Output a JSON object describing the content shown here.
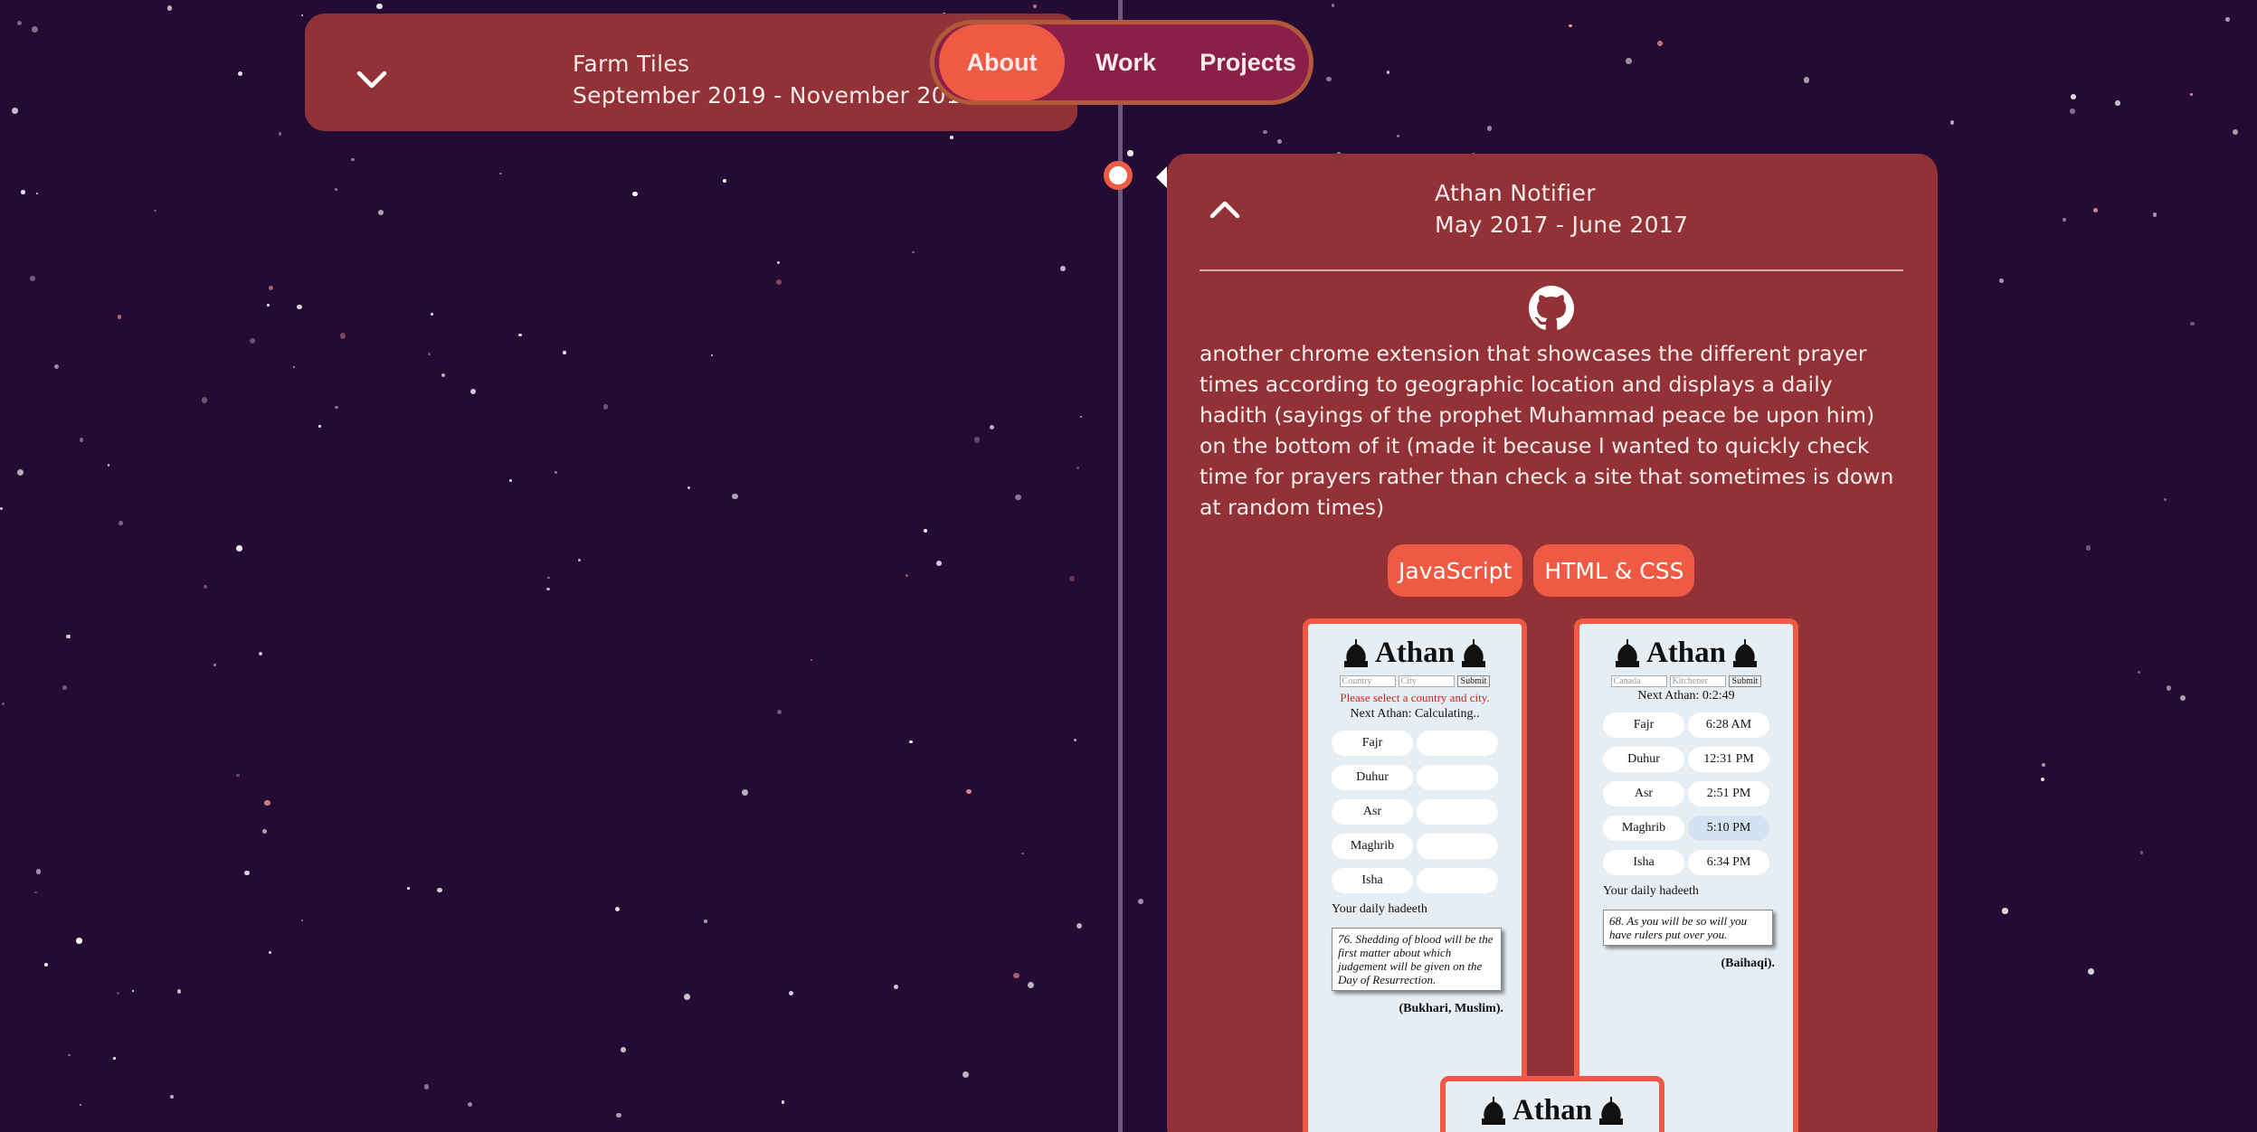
{
  "nav": {
    "items": [
      {
        "label": "About",
        "active": true
      },
      {
        "label": "Work",
        "active": false
      },
      {
        "label": "Projects",
        "active": false
      }
    ]
  },
  "top_card": {
    "title": "Farm Tiles",
    "dates": "September 2019 - November 2019",
    "toggle_icon": "chevron-down-icon"
  },
  "main_card": {
    "title": "Athan Notifier",
    "dates": "May 2017 - June 2017",
    "toggle_icon": "chevron-up-icon",
    "link_icon": "github-icon",
    "description": "another chrome extension that showcases the different prayer times according to geographic location and displays a daily hadith (sayings of the prophet Muhammad peace be upon him) on the bottom of it (made it because I wanted to quickly check time for prayers rather than check a site that sometimes is down at random times)",
    "tags": [
      "JavaScript",
      "HTML & CSS"
    ]
  },
  "screenshots": [
    {
      "heading": "Athan",
      "country_placeholder": "Country",
      "city_placeholder": "City",
      "submit": "Submit",
      "warning": "Please select a country and city.",
      "next_athan": "Next Athan: Calculating..",
      "prayers": [
        {
          "name": "Fajr",
          "time": ""
        },
        {
          "name": "Duhur",
          "time": ""
        },
        {
          "name": "Asr",
          "time": ""
        },
        {
          "name": "Maghrib",
          "time": ""
        },
        {
          "name": "Isha",
          "time": ""
        }
      ],
      "daily_label": "Your daily hadeeth",
      "hadith": "76. Shedding of blood will be the first matter about which judgement will be given on the Day of Resurrection.",
      "source": "(Bukhari, Muslim)."
    },
    {
      "heading": "Athan",
      "country_placeholder": "Canada",
      "city_placeholder": "Kitchener",
      "submit": "Submit",
      "next_athan": "Next Athan: 0:2:49",
      "prayers": [
        {
          "name": "Fajr",
          "time": "6:28 AM"
        },
        {
          "name": "Duhur",
          "time": "12:31 PM"
        },
        {
          "name": "Asr",
          "time": "2:51 PM"
        },
        {
          "name": "Maghrib",
          "time": "5:10 PM"
        },
        {
          "name": "Isha",
          "time": "6:34 PM"
        }
      ],
      "daily_label": "Your daily hadeeth",
      "hadith": "68. As you will be so will you have rulers put over you.",
      "source": "(Baihaqi)."
    },
    {
      "heading": "Athan"
    }
  ],
  "colors": {
    "background": "#230b33",
    "card": "#923237",
    "accent": "#ef5a45",
    "nav_bg": "#8a2048"
  }
}
